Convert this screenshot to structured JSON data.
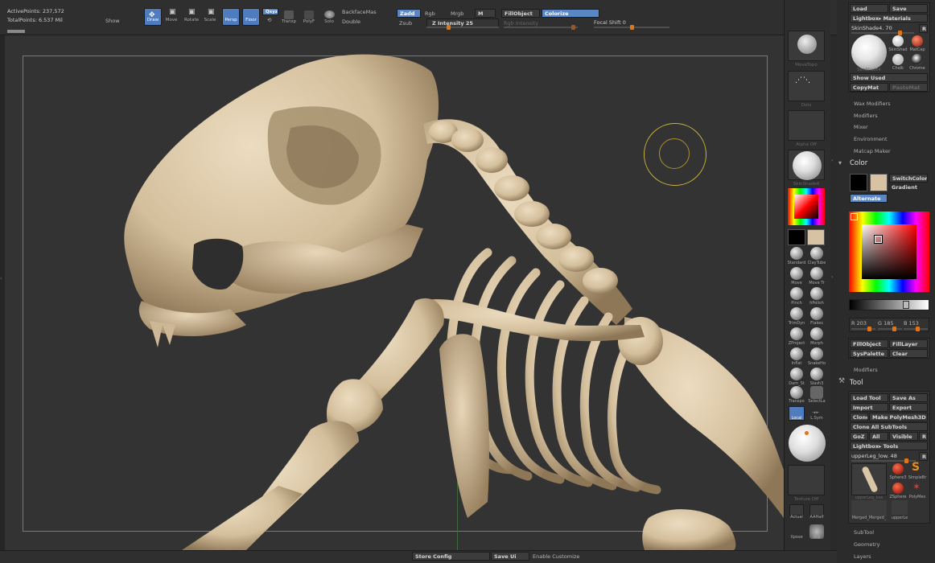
{
  "info": {
    "active_points": "ActivePoints: 237,572",
    "total_points": "TotalPoints: 6.537 Mil",
    "show": "Show"
  },
  "toolbar": {
    "draw": "Draw",
    "move": "Move",
    "rotate": "Rotate",
    "scale": "Scale",
    "persp": "Persp",
    "floor": "Floor",
    "local": "Qxyz",
    "transp": "Transp",
    "polyf": "PolyF",
    "solo": "Solo",
    "backfacemask": "BackfaceMas",
    "double": "Double",
    "zadd": "Zadd",
    "zsub": "Zsub",
    "rgb": "Rgb",
    "mrgb": "Mrgb",
    "m": "M",
    "z_intensity": "Z Intensity 25",
    "rgb_intensity": "Rgb Intensity",
    "fillobject": "FillObject",
    "colorize": "Colorize",
    "focal_shift": "Focal Shift 0"
  },
  "shelf": {
    "brush_cap": "MoveTopo",
    "stroke_cap": "Dots",
    "alpha_cap": "Alpha Off",
    "material_cap": "SkinShade4",
    "texture_cap": "Texture Off",
    "brushes": [
      {
        "name": "Standard"
      },
      {
        "name": "ClayTube"
      },
      {
        "name": "Move"
      },
      {
        "name": "Move Tr"
      },
      {
        "name": "Pinch"
      },
      {
        "name": "hPolish"
      },
      {
        "name": "TrimDyn"
      },
      {
        "name": "Flakes"
      },
      {
        "name": "ZProject"
      },
      {
        "name": "Morph"
      },
      {
        "name": "Inflat"
      },
      {
        "name": "SnakeHo"
      },
      {
        "name": "Dam_St"
      },
      {
        "name": "Slash3"
      },
      {
        "name": "Transpo"
      },
      {
        "name": "SelectLa"
      }
    ],
    "local": "Local",
    "lsym": "L.Sym",
    "actual": "Actual",
    "aahalf": "AAHalf",
    "xpose": "Xpose",
    "grp": "Grp"
  },
  "colors": {
    "main": "#000000",
    "secondary": "#d7c3a3",
    "bone": "#d9c6a6",
    "accent": "#e0741a",
    "active": "#5b86c4"
  },
  "material": {
    "load": "Load",
    "save": "Save",
    "lightbox": "Lightbox▸ Materials",
    "current": "SkinShade4. 70",
    "r": "R",
    "thumb_main": "SkinShade4",
    "thumb1": "SkinShad",
    "thumb2": "MatCap",
    "thumb3": "Chalk",
    "thumb4": "Chrome",
    "show_used": "Show Used",
    "copymat": "CopyMat",
    "pastemat": "PasteMat",
    "items": [
      "Wax Modifiers",
      "Modifiers",
      "Mixer",
      "Environment",
      "Matcap Maker"
    ]
  },
  "color_palette": {
    "title": "Color",
    "switch": "SwitchColor",
    "gradient": "Gradient",
    "alternate": "Alternate",
    "r": "R 203",
    "g": "G 185",
    "b": "B 153",
    "fillobject": "FillObject",
    "filllayer": "FillLayer",
    "syspalette": "SysPalette",
    "clear": "Clear",
    "modifiers": "Modifiers"
  },
  "tool": {
    "title": "Tool",
    "load": "Load Tool",
    "saveas": "Save As",
    "import": "Import",
    "export": "Export",
    "clone": "Clone",
    "make": "Make PolyMesh3D",
    "clone_all": "Clone All SubTools",
    "goz": "GoZ",
    "all": "All",
    "visible": "Visible",
    "r": "R",
    "lightbox": "Lightbox▸ Tools",
    "current": "upperLeg_low. 48",
    "thumb_main": "upperLeg_low",
    "thumb1": "Sphere3",
    "thumb2": "SimpleBr",
    "thumb3": "ZSphere",
    "thumb4": "PolyMes",
    "thumb5": "Merged_Merged_",
    "thumb6": "upperLe",
    "items": [
      "SubTool",
      "Geometry",
      "Layers"
    ]
  },
  "bottom": {
    "store": "Store Config",
    "save_ui": "Save Ui",
    "enable": "Enable Customize"
  }
}
